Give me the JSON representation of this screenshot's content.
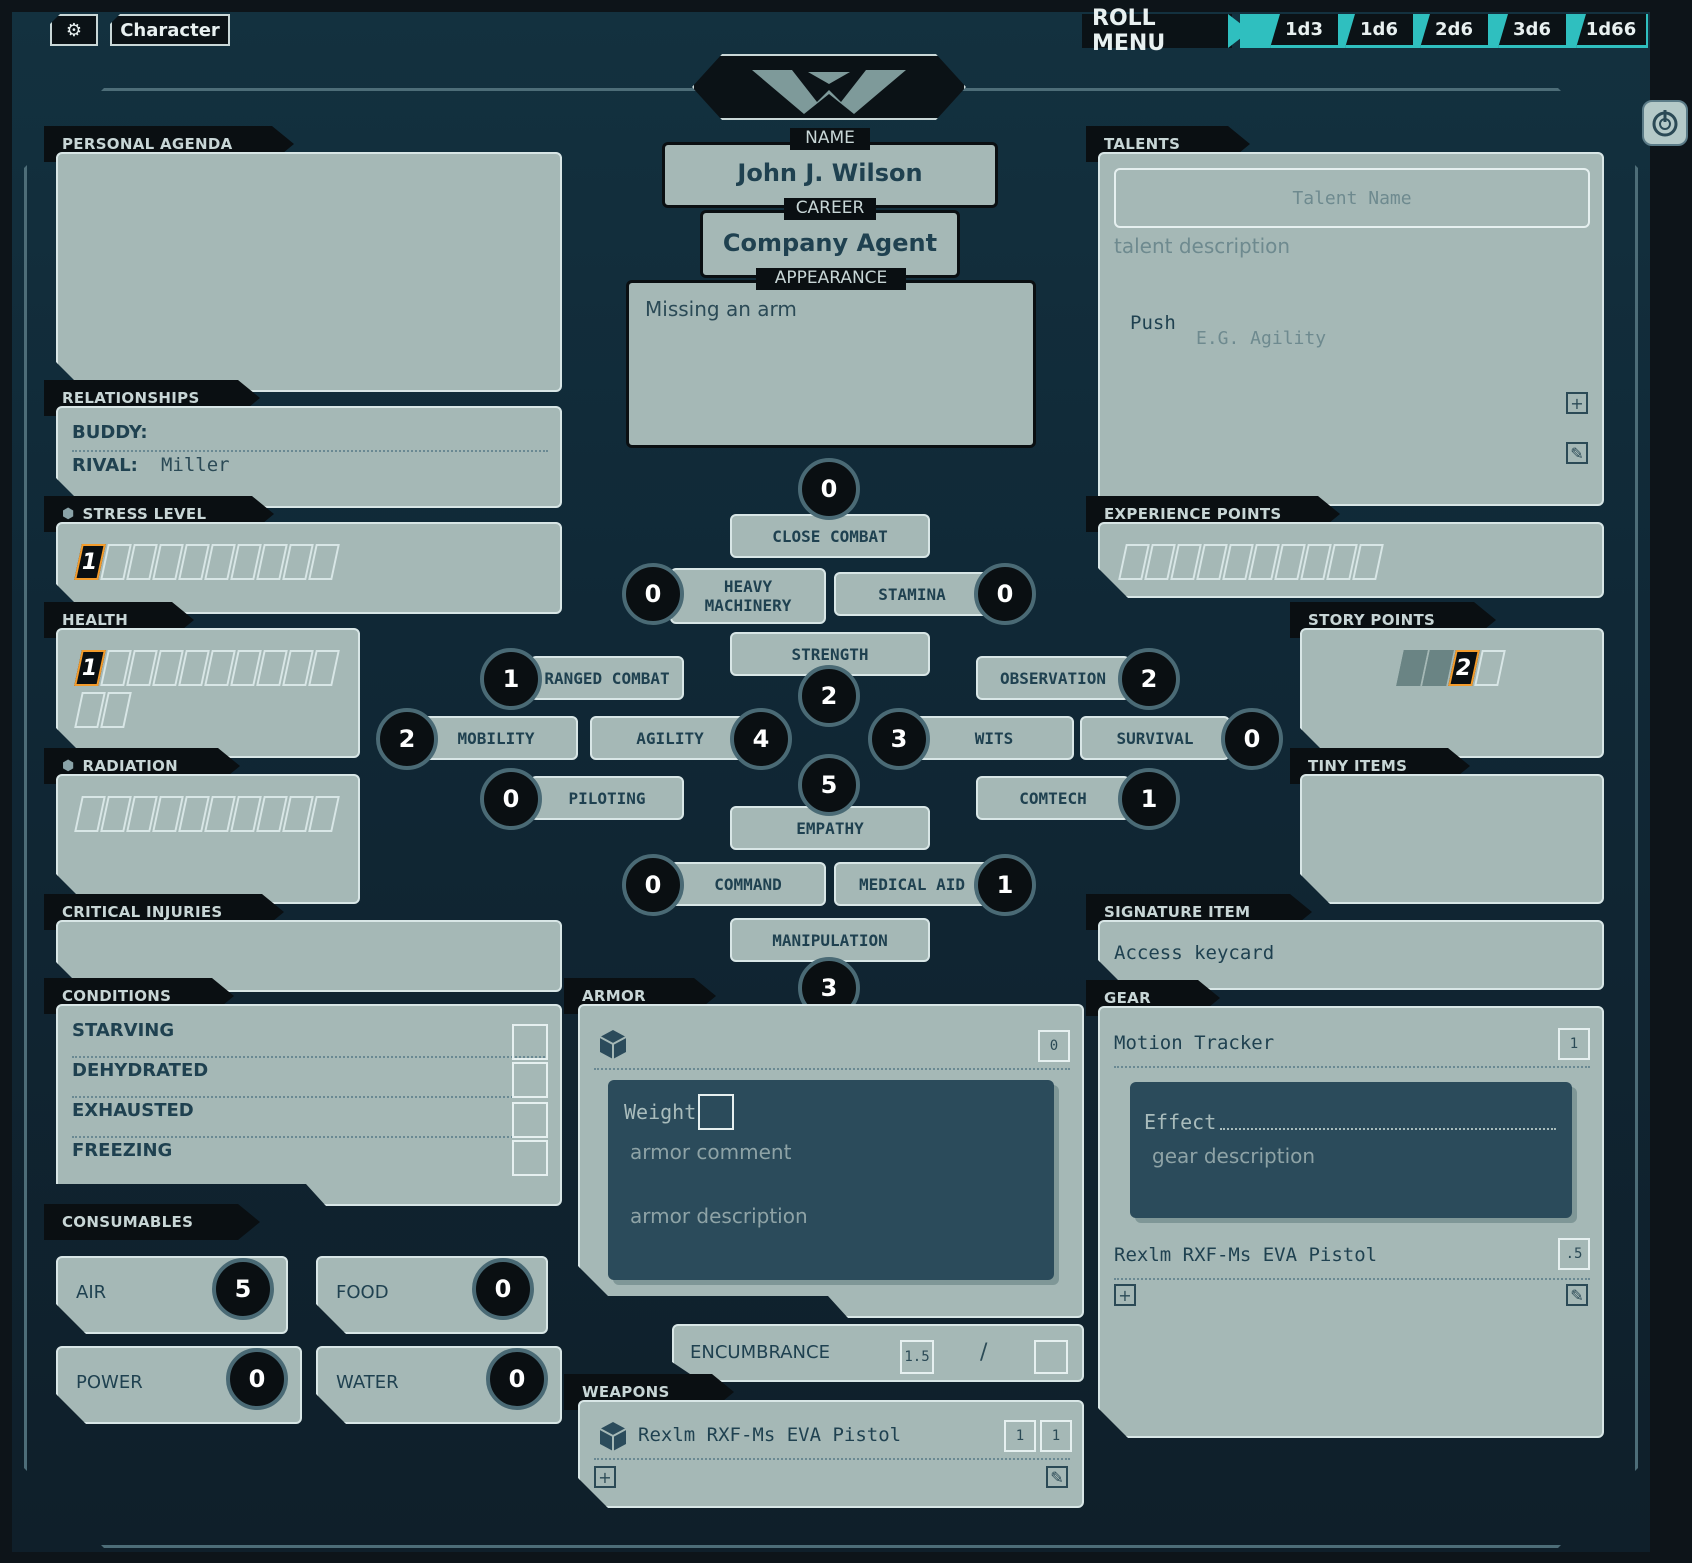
{
  "topbar": {
    "settings_icon": "gear-icon",
    "tab_label": "Character",
    "roll_menu_label": "ROLL MENU",
    "dice": [
      "1d3",
      "1d6",
      "2d6",
      "3d6",
      "1d66"
    ]
  },
  "identity": {
    "name_label": "NAME",
    "name_value": "John J. Wilson",
    "career_label": "CAREER",
    "career_value": "Company Agent",
    "appearance_label": "APPEARANCE",
    "appearance_value": "Missing an arm"
  },
  "personal_agenda": {
    "label": "PERSONAL AGENDA",
    "value": ""
  },
  "relationships": {
    "label": "RELATIONSHIPS",
    "buddy_label": "BUDDY:",
    "buddy_value": "",
    "rival_label": "RIVAL:",
    "rival_value": "Miller"
  },
  "stress": {
    "label": "STRESS LEVEL",
    "value": "1",
    "max": 10
  },
  "health": {
    "label": "HEALTH",
    "value": "1",
    "max": 12
  },
  "radiation": {
    "label": "RADIATION",
    "value": 0,
    "max": 10
  },
  "critical_injuries": {
    "label": "CRITICAL INJURIES"
  },
  "conditions": {
    "label": "CONDITIONS",
    "items": [
      "STARVING",
      "DEHYDRATED",
      "EXHAUSTED",
      "FREEZING"
    ]
  },
  "consumables": {
    "label": "CONSUMABLES",
    "items": [
      {
        "name": "AIR",
        "value": "5"
      },
      {
        "name": "FOOD",
        "value": "0"
      },
      {
        "name": "POWER",
        "value": "0"
      },
      {
        "name": "WATER",
        "value": "0"
      }
    ]
  },
  "attributes": {
    "close_combat": {
      "label": "CLOSE COMBAT",
      "value": "0"
    },
    "heavy_machinery": {
      "label": "HEAVY MACHINERY",
      "value": "0"
    },
    "stamina": {
      "label": "STAMINA",
      "value": "0"
    },
    "strength": {
      "label": "STRENGTH",
      "value": "2"
    },
    "ranged_combat": {
      "label": "RANGED COMBAT",
      "value": "1"
    },
    "mobility": {
      "label": "MOBILITY",
      "value": "2"
    },
    "agility": {
      "label": "AGILITY",
      "value": "4"
    },
    "piloting": {
      "label": "PILOTING",
      "value": "0"
    },
    "observation": {
      "label": "OBSERVATION",
      "value": "2"
    },
    "wits": {
      "label": "WITS",
      "value": "3"
    },
    "survival": {
      "label": "SURVIVAL",
      "value": "0"
    },
    "comtech": {
      "label": "COMTECH",
      "value": "1"
    },
    "empathy": {
      "label": "EMPATHY",
      "value": "5"
    },
    "command": {
      "label": "COMMAND",
      "value": "0"
    },
    "medical_aid": {
      "label": "MEDICAL AID",
      "value": "1"
    },
    "manipulation": {
      "label": "MANIPULATION",
      "value": "3"
    }
  },
  "armor": {
    "label": "ARMOR",
    "rating": "0",
    "weight_label": "Weight",
    "comment_placeholder": "armor comment",
    "description_placeholder": "armor description"
  },
  "encumbrance": {
    "label": "ENCUMBRANCE",
    "current": "1.5",
    "separator": "/",
    "max": ""
  },
  "weapons": {
    "label": "WEAPONS",
    "items": [
      {
        "name": "Rexlm RXF-Ms EVA Pistol",
        "a": "1",
        "b": "1"
      }
    ]
  },
  "talents": {
    "label": "TALENTS",
    "name_placeholder": "Talent Name",
    "description_placeholder": "talent description",
    "push_label": "Push",
    "push_placeholder": "E.G. Agility"
  },
  "experience": {
    "label": "EXPERIENCE POINTS",
    "value": 0,
    "max": 10
  },
  "story_points": {
    "label": "STORY POINTS",
    "value": "2"
  },
  "tiny_items": {
    "label": "TINY ITEMS"
  },
  "signature_item": {
    "label": "SIGNATURE ITEM",
    "value": "Access keycard"
  },
  "gear": {
    "label": "GEAR",
    "items": [
      {
        "name": "Motion Tracker",
        "weight": "1",
        "effect_label": "Effect",
        "description_placeholder": "gear description"
      },
      {
        "name": "Rexlm RXF-Ms EVA Pistol",
        "weight": ".5"
      }
    ]
  }
}
